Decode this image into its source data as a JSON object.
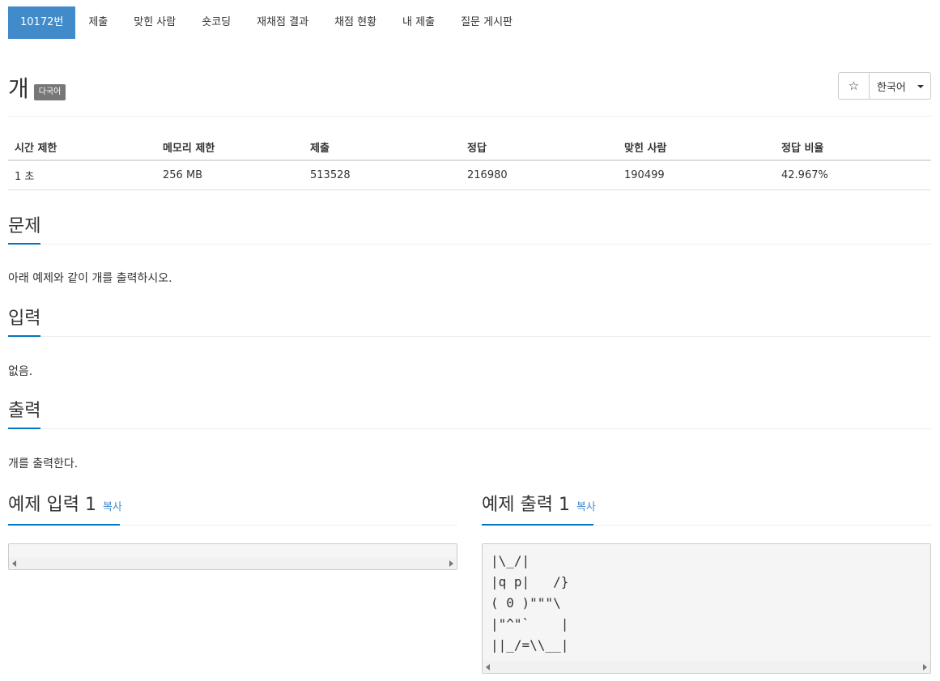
{
  "tabs": [
    {
      "label": "10172번",
      "active": true
    },
    {
      "label": "제출"
    },
    {
      "label": "맞힌 사람"
    },
    {
      "label": "숏코딩"
    },
    {
      "label": "재채점 결과"
    },
    {
      "label": "채점 현황"
    },
    {
      "label": "내 제출"
    },
    {
      "label": "질문 게시판"
    }
  ],
  "problem": {
    "title": "개",
    "badge": "다국어",
    "star_icon": "☆",
    "language": "한국어"
  },
  "info_table": {
    "headers": [
      "시간 제한",
      "메모리 제한",
      "제출",
      "정답",
      "맞힌 사람",
      "정답 비율"
    ],
    "values": [
      "1 초",
      "256 MB",
      "513528",
      "216980",
      "190499",
      "42.967%"
    ]
  },
  "sections": {
    "problem": {
      "heading": "문제",
      "text": "아래 예제와 같이 개를 출력하시오."
    },
    "input": {
      "heading": "입력",
      "text": "없음."
    },
    "output": {
      "heading": "출력",
      "text": "개를 출력한다."
    }
  },
  "samples": {
    "input": {
      "heading": "예제 입력 1",
      "copy_label": "복사",
      "content": ""
    },
    "output": {
      "heading": "예제 출력 1",
      "copy_label": "복사",
      "content": "|\\_/|\n|q p|   /}\n( 0 )\"\"\"\\\n|\"^\"`    |\n||_/=\\\\__|"
    }
  },
  "colors": {
    "accent": "#428bca",
    "section_rule": "#0076c0",
    "badge": "#777777"
  }
}
